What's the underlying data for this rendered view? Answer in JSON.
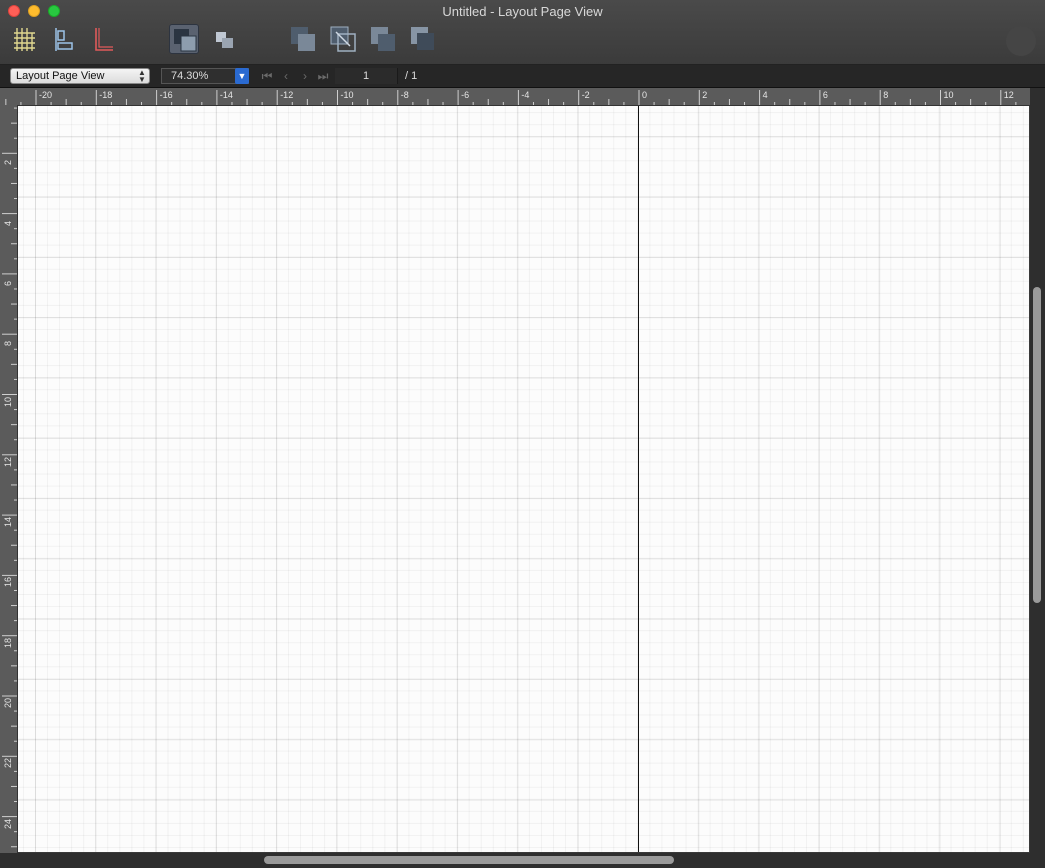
{
  "window": {
    "title": "Untitled - Layout Page View"
  },
  "toolbar": {
    "tools": [
      {
        "name": "grid-tool",
        "pressed": false
      },
      {
        "name": "align-tool",
        "pressed": false
      },
      {
        "name": "margins-tool",
        "pressed": false
      },
      {
        "name": "bring-front-tool",
        "pressed": true
      },
      {
        "name": "send-back-tool",
        "pressed": false
      },
      {
        "name": "bring-forward-tool",
        "pressed": false
      },
      {
        "name": "group-tool",
        "pressed": false
      },
      {
        "name": "send-backward-tool",
        "pressed": false
      },
      {
        "name": "arrange-tool",
        "pressed": false
      }
    ]
  },
  "navbar": {
    "view_mode": "Layout Page View",
    "zoom": "74.30%",
    "page_number": "1",
    "page_total": "/ 1"
  },
  "rulers": {
    "horizontal": [
      "-20",
      "-18",
      "-16",
      "-14",
      "-12",
      "-10",
      "-8",
      "-6",
      "-4",
      "-2",
      "0",
      "2",
      "4",
      "6",
      "8",
      "10",
      "12"
    ],
    "vertical": [
      "2",
      "4",
      "6",
      "8",
      "10",
      "12",
      "14",
      "16",
      "18",
      "20",
      "22",
      "24"
    ]
  },
  "colors": {
    "close": "#ff5f57",
    "minimize": "#febc2e",
    "maximize": "#28c840",
    "zoom_dropdown": "#2a6ad1"
  }
}
